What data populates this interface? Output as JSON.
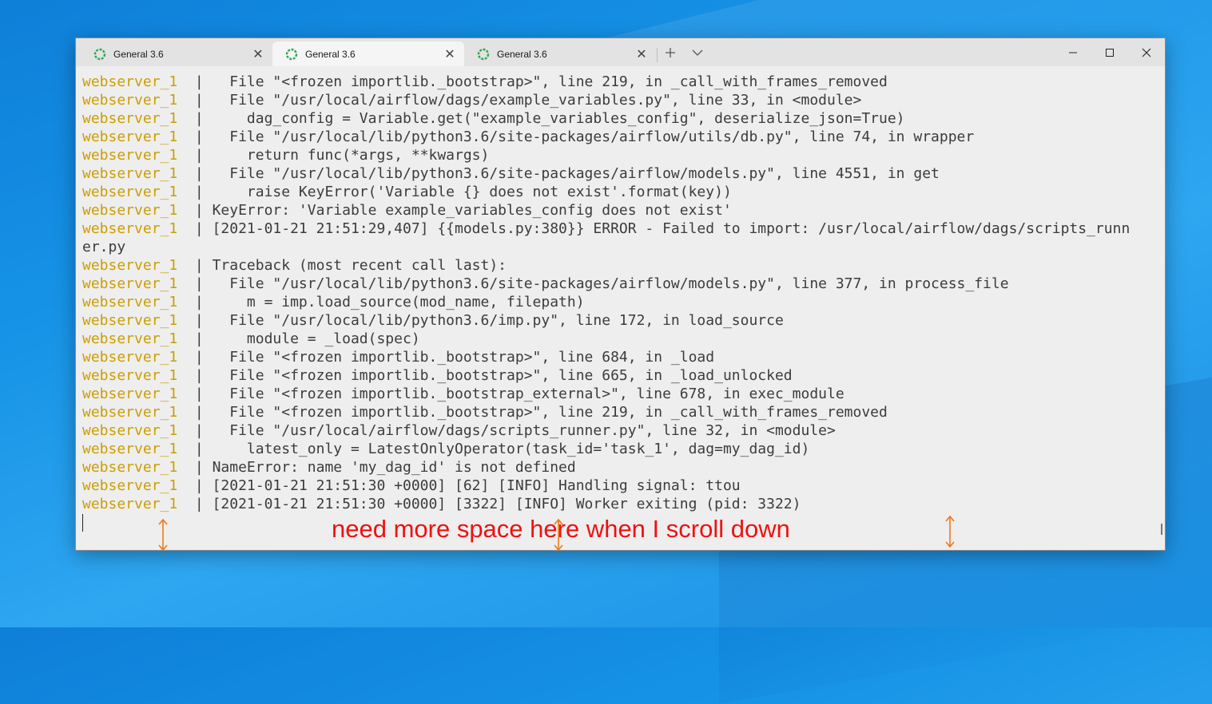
{
  "tabs": [
    {
      "label": "General 3.6",
      "active": false
    },
    {
      "label": "General 3.6",
      "active": true
    },
    {
      "label": "General 3.6",
      "active": false
    }
  ],
  "icons": {
    "tab_icon": "spinner-ring-icon",
    "tab_close": "close-icon",
    "new_tab": "plus-icon",
    "dropdown": "chevron-down-icon",
    "minimize": "minimize-icon",
    "maximize": "maximize-icon",
    "close_window": "close-window-icon"
  },
  "colors": {
    "service_prefix": "#cc9e00",
    "annotation": "#ee1111",
    "arrow": "#f07818",
    "spinner": "#2fa84f"
  },
  "terminal": {
    "lines": [
      {
        "svc": "webserver_1",
        "text": "  |   File \"<frozen importlib._bootstrap>\", line 219, in _call_with_frames_removed"
      },
      {
        "svc": "webserver_1",
        "text": "  |   File \"/usr/local/airflow/dags/example_variables.py\", line 33, in <module>"
      },
      {
        "svc": "webserver_1",
        "text": "  |     dag_config = Variable.get(\"example_variables_config\", deserialize_json=True)"
      },
      {
        "svc": "webserver_1",
        "text": "  |   File \"/usr/local/lib/python3.6/site-packages/airflow/utils/db.py\", line 74, in wrapper"
      },
      {
        "svc": "webserver_1",
        "text": "  |     return func(*args, **kwargs)"
      },
      {
        "svc": "webserver_1",
        "text": "  |   File \"/usr/local/lib/python3.6/site-packages/airflow/models.py\", line 4551, in get"
      },
      {
        "svc": "webserver_1",
        "text": "  |     raise KeyError('Variable {} does not exist'.format(key))"
      },
      {
        "svc": "webserver_1",
        "text": "  | KeyError: 'Variable example_variables_config does not exist'"
      },
      {
        "svc": "webserver_1",
        "text": "  | [2021-01-21 21:51:29,407] {{models.py:380}} ERROR - Failed to import: /usr/local/airflow/dags/scripts_runn"
      },
      {
        "svc": "",
        "text": "er.py"
      },
      {
        "svc": "webserver_1",
        "text": "  | Traceback (most recent call last):"
      },
      {
        "svc": "webserver_1",
        "text": "  |   File \"/usr/local/lib/python3.6/site-packages/airflow/models.py\", line 377, in process_file"
      },
      {
        "svc": "webserver_1",
        "text": "  |     m = imp.load_source(mod_name, filepath)"
      },
      {
        "svc": "webserver_1",
        "text": "  |   File \"/usr/local/lib/python3.6/imp.py\", line 172, in load_source"
      },
      {
        "svc": "webserver_1",
        "text": "  |     module = _load(spec)"
      },
      {
        "svc": "webserver_1",
        "text": "  |   File \"<frozen importlib._bootstrap>\", line 684, in _load"
      },
      {
        "svc": "webserver_1",
        "text": "  |   File \"<frozen importlib._bootstrap>\", line 665, in _load_unlocked"
      },
      {
        "svc": "webserver_1",
        "text": "  |   File \"<frozen importlib._bootstrap_external>\", line 678, in exec_module"
      },
      {
        "svc": "webserver_1",
        "text": "  |   File \"<frozen importlib._bootstrap>\", line 219, in _call_with_frames_removed"
      },
      {
        "svc": "webserver_1",
        "text": "  |   File \"/usr/local/airflow/dags/scripts_runner.py\", line 32, in <module>"
      },
      {
        "svc": "webserver_1",
        "text": "  |     latest_only = LatestOnlyOperator(task_id='task_1', dag=my_dag_id)"
      },
      {
        "svc": "webserver_1",
        "text": "  | NameError: name 'my_dag_id' is not defined"
      },
      {
        "svc": "webserver_1",
        "text": "  | [2021-01-21 21:51:30 +0000] [62] [INFO] Handling signal: ttou"
      },
      {
        "svc": "webserver_1",
        "text": "  | [2021-01-21 21:51:30 +0000] [3322] [INFO] Worker exiting (pid: 3322)"
      }
    ]
  },
  "annotation": {
    "text": "need more space here when I scroll down"
  }
}
